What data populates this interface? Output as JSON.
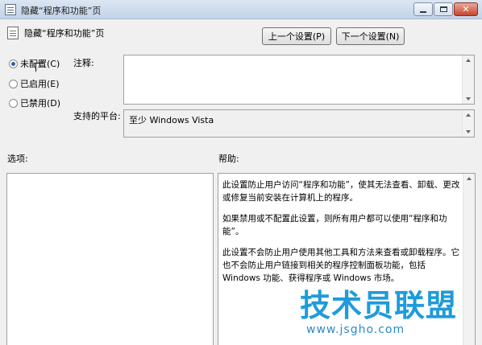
{
  "window": {
    "title": "隐藏“程序和功能”页",
    "close_glyph": "✕"
  },
  "policy": {
    "title": "隐藏“程序和功能”页"
  },
  "navigation": {
    "prev_label": "上一个设置(P)",
    "next_label": "下一个设置(N)"
  },
  "state": {
    "options": [
      {
        "label": "未配置(C)",
        "checked": true
      },
      {
        "label": "已启用(E)",
        "checked": false
      },
      {
        "label": "已禁用(D)",
        "checked": false
      }
    ]
  },
  "fields": {
    "comment_label": "注释:",
    "comment_value": "",
    "platform_label": "支持的平台:",
    "platform_value": "至少 Windows Vista"
  },
  "sections": {
    "options_label": "选项:",
    "help_label": "帮助:"
  },
  "help": {
    "paragraphs": [
      "此设置防止用户访问“程序和功能”，使其无法查看、卸载、更改或修复当前安装在计算机上的程序。",
      "如果禁用或不配置此设置，则所有用户都可以使用“程序和功能”。",
      "此设置不会防止用户使用其他工具和方法来查看或卸载程序。它也不会防止用户链接到相关的程序控制面板功能，包括 Windows 功能、获得程序或 Windows 市场。"
    ]
  },
  "watermark": {
    "main": "技术员联盟",
    "sub": "www.jsgho.com"
  }
}
